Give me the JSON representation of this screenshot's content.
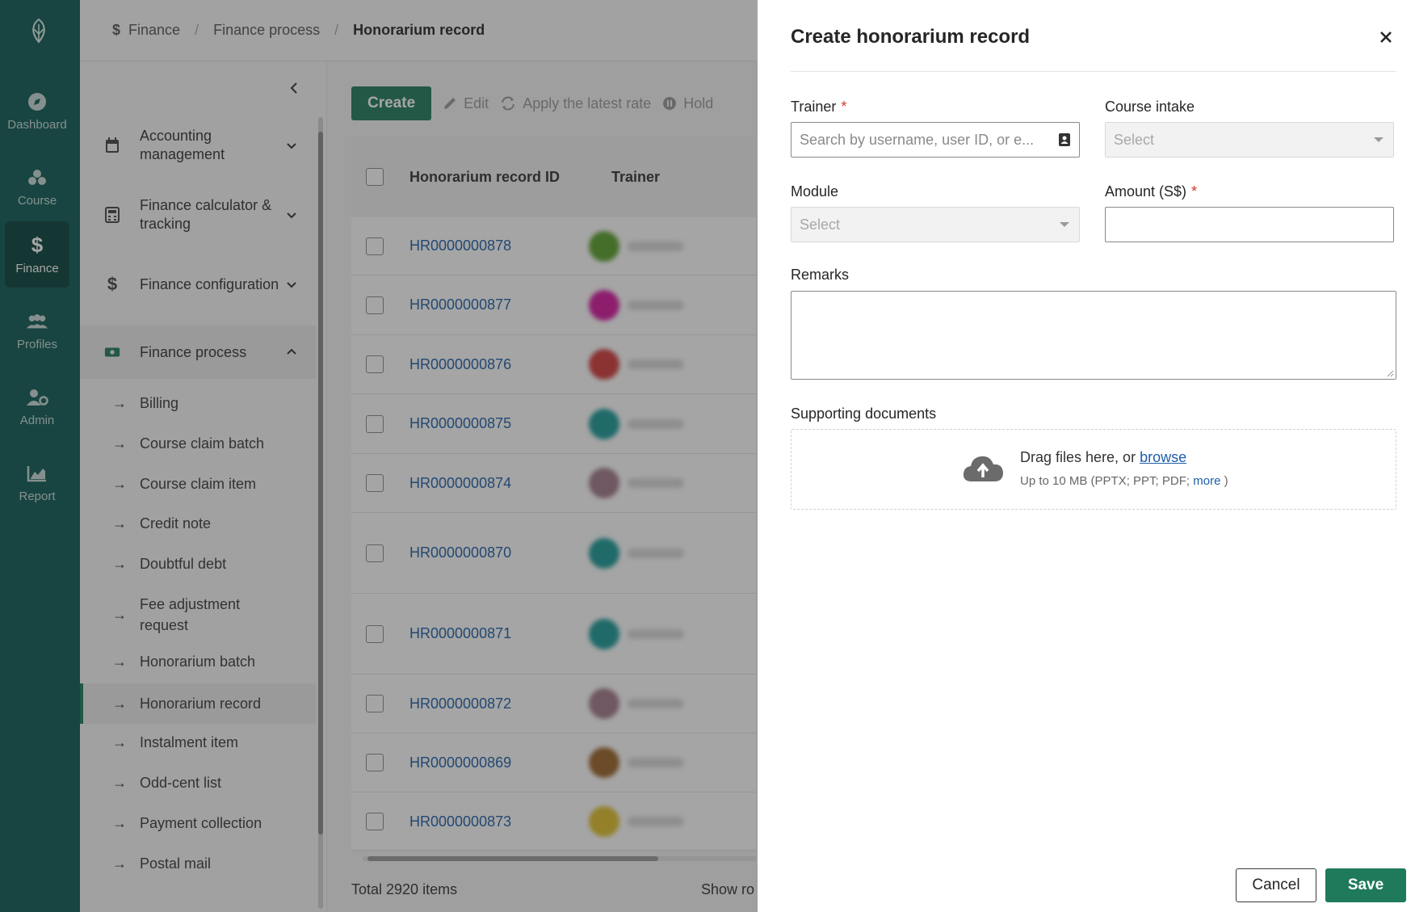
{
  "rail": {
    "items": [
      {
        "label": "Dashboard",
        "icon": "compass-icon"
      },
      {
        "label": "Course",
        "icon": "course-icon"
      },
      {
        "label": "Finance",
        "icon": "dollar-icon",
        "active": true
      },
      {
        "label": "Profiles",
        "icon": "people-icon"
      },
      {
        "label": "Admin",
        "icon": "user-gear-icon"
      },
      {
        "label": "Report",
        "icon": "chart-icon"
      }
    ]
  },
  "breadcrumb": {
    "items": [
      "Finance",
      "Finance process",
      "Honorarium record"
    ]
  },
  "subnav": {
    "groups": [
      {
        "label": "Accounting management",
        "icon": "calendar-icon"
      },
      {
        "label": "Finance calculator & tracking",
        "icon": "calculator-icon"
      },
      {
        "label": "Finance configuration",
        "icon": "dollar-icon"
      },
      {
        "label": "Finance process",
        "icon": "cash-icon"
      }
    ],
    "items": [
      "Billing",
      "Course claim batch",
      "Course claim item",
      "Credit note",
      "Doubtful debt",
      "Fee adjustment request",
      "Honorarium batch",
      "Honorarium record",
      "Instalment item",
      "Odd-cent list",
      "Payment collection",
      "Postal mail"
    ],
    "active_item": "Honorarium record"
  },
  "toolbar": {
    "create": "Create",
    "edit": "Edit",
    "apply_rate": "Apply the latest rate",
    "hold": "Hold"
  },
  "table": {
    "headers": [
      "Honorarium record ID",
      "Trainer"
    ],
    "rows": [
      {
        "id": "HR0000000878",
        "avatar_color": "#5aa02c"
      },
      {
        "id": "HR0000000877",
        "avatar_color": "#d5179f"
      },
      {
        "id": "HR0000000876",
        "avatar_color": "#d23a3a"
      },
      {
        "id": "HR0000000875",
        "avatar_color": "#1a9a98"
      },
      {
        "id": "HR0000000874",
        "avatar_color": "#a27a8a"
      },
      {
        "id": "HR0000000870",
        "avatar_color": "#1a9a98"
      },
      {
        "id": "HR0000000871",
        "avatar_color": "#1a9a98"
      },
      {
        "id": "HR0000000872",
        "avatar_color": "#a27a8a"
      },
      {
        "id": "HR0000000869",
        "avatar_color": "#9b6428"
      },
      {
        "id": "HR0000000873",
        "avatar_color": "#e0c02a"
      }
    ]
  },
  "footer": {
    "total": "Total 2920 items",
    "show": "Show ro"
  },
  "drawer": {
    "title": "Create honorarium record",
    "trainer_label": "Trainer",
    "trainer_placeholder": "Search by username, user ID, or e...",
    "course_intake_label": "Course intake",
    "course_intake_value": "Select",
    "module_label": "Module",
    "module_value": "Select",
    "amount_label": "Amount (S$)",
    "amount_value": "",
    "remarks_label": "Remarks",
    "supporting_label": "Supporting documents",
    "dz_text": "Drag files here, or ",
    "dz_browse": "browse",
    "dz_sub": "Up to 10 MB (PPTX; PPT; PDF; ",
    "dz_more": "more",
    "dz_close_paren": " )",
    "required_mark": "*",
    "cancel": "Cancel",
    "save": "Save"
  },
  "colors": {
    "rail_bg": "#0d5b53",
    "primary": "#1f7a5c",
    "link": "#1f5fa8",
    "required": "#d1382b"
  }
}
